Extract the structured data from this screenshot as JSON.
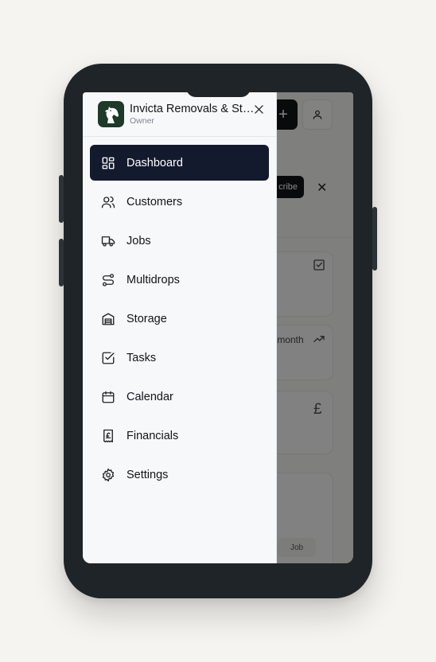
{
  "drawer": {
    "business_name": "Invicta Removals & Storage",
    "role": "Owner",
    "close_label": "×",
    "items": [
      {
        "label": "Dashboard",
        "icon": "dashboard-icon",
        "active": true
      },
      {
        "label": "Customers",
        "icon": "users-icon",
        "active": false
      },
      {
        "label": "Jobs",
        "icon": "truck-icon",
        "active": false
      },
      {
        "label": "Multidrops",
        "icon": "route-icon",
        "active": false
      },
      {
        "label": "Storage",
        "icon": "warehouse-icon",
        "active": false
      },
      {
        "label": "Tasks",
        "icon": "check-square-icon",
        "active": false
      },
      {
        "label": "Calendar",
        "icon": "calendar-icon",
        "active": false
      },
      {
        "label": "Financials",
        "icon": "receipt-pound-icon",
        "active": false
      },
      {
        "label": "Settings",
        "icon": "gear-icon",
        "active": false
      }
    ]
  },
  "background": {
    "add_label": "+",
    "subscribe_label": "cribe",
    "close_label": "✕",
    "month_text": "s month",
    "pound_symbol": "£",
    "job_button_label": "Job"
  },
  "colors": {
    "active_bg": "#141a2e",
    "logo_bg": "#1d3a2a",
    "phone_frame": "#1f2428"
  }
}
